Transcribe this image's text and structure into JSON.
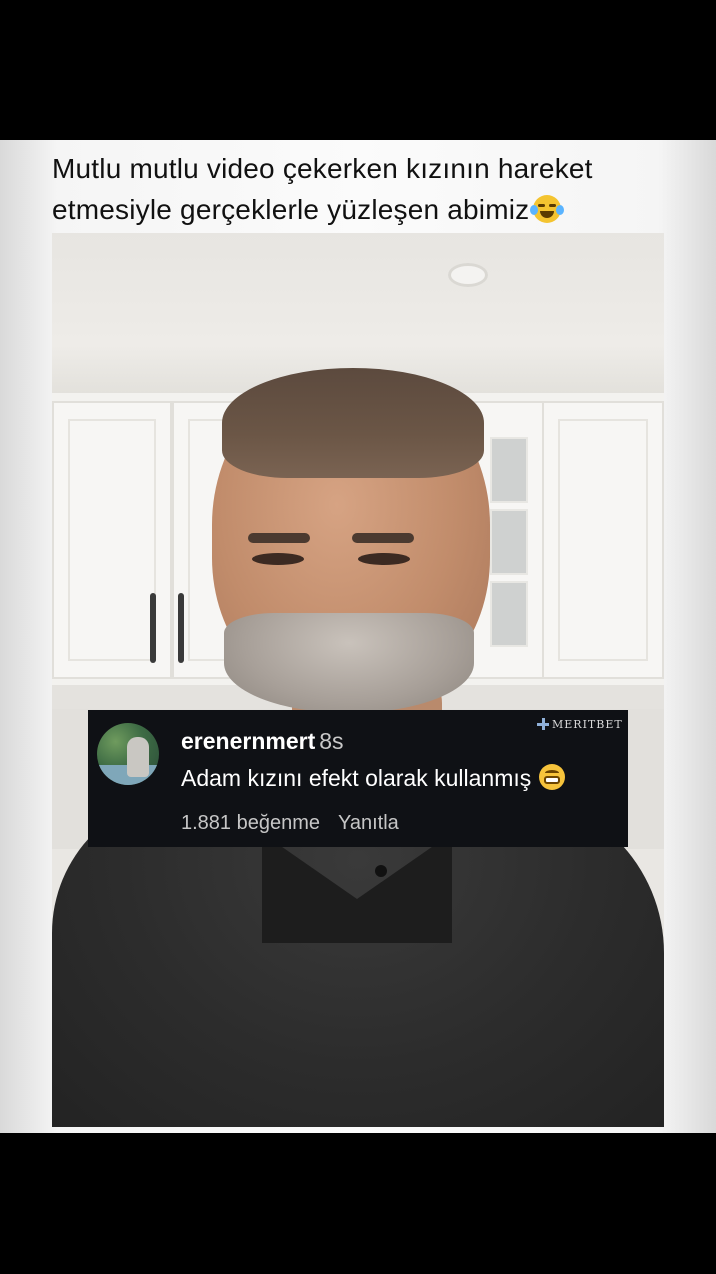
{
  "post": {
    "caption": "Mutlu mutlu video çekerken kızının hareket etmesiyle gerçeklerle yüzleşen abimiz"
  },
  "caption_emoji": "face-with-tears-of-joy-icon",
  "comment": {
    "username": "erenernmert",
    "time_ago": "8s",
    "text": "Adam kızını efekt olarak kullanmış",
    "emoji": "grinning-face-icon",
    "likes": "1.881 beğenme",
    "reply_label": "Yanıtla"
  },
  "watermark": {
    "text": "MERITBET"
  },
  "colors": {
    "background": "#000000",
    "card": "#f7f7f7",
    "comment_bg": "#0f1115",
    "comment_text": "#ffffff",
    "comment_meta": "#c6c6c6"
  }
}
